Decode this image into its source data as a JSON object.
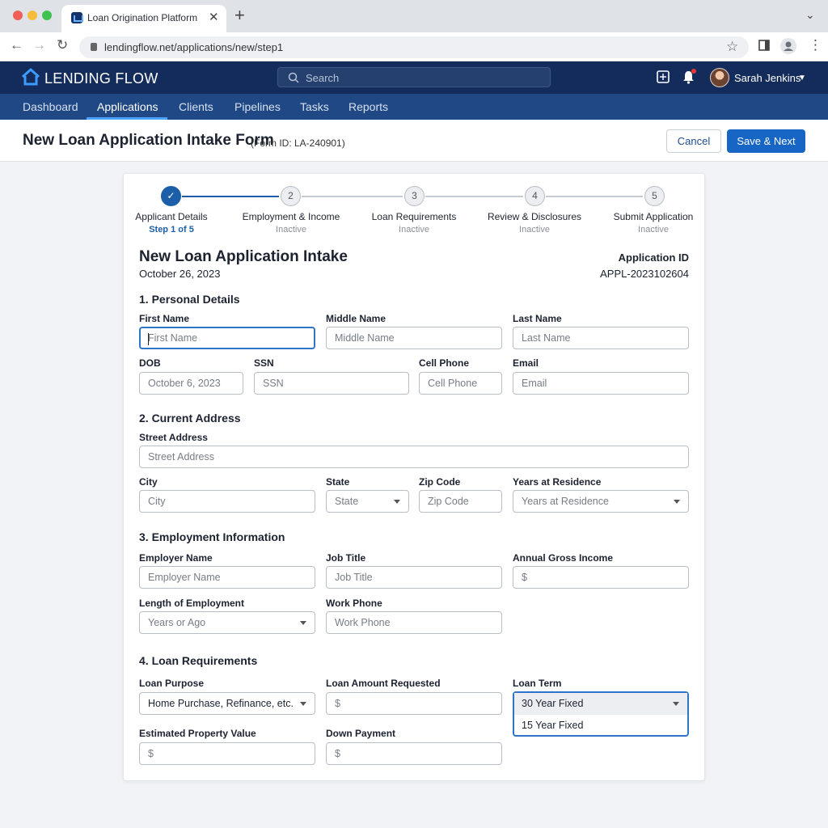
{
  "browser": {
    "tab_title": "Loan Origination Platform",
    "url": "lendingflow.net/applications/new/step1"
  },
  "app": {
    "brand": "LENDING FLOW",
    "search_placeholder": "Search",
    "user_name": "Sarah Jenkins",
    "nav": [
      "Dashboard",
      "Applications",
      "Clients",
      "Pipelines",
      "Tasks",
      "Reports"
    ],
    "active_nav": "Applications"
  },
  "page": {
    "title": "New Loan Application Intake Form",
    "form_id": "(Form ID: LA-240901)",
    "cancel_label": "Cancel",
    "save_label": "Save & Next"
  },
  "stepper": [
    {
      "number": "✓",
      "label": "Applicant Details",
      "status": "Step 1 of 5",
      "state": "done"
    },
    {
      "number": "2",
      "label": "Employment & Income",
      "status": "Inactive",
      "state": "todo"
    },
    {
      "number": "3",
      "label": "Loan Requirements",
      "status": "Inactive",
      "state": "todo"
    },
    {
      "number": "4",
      "label": "Review & Disclosures",
      "status": "Inactive",
      "state": "todo"
    },
    {
      "number": "5",
      "label": "Submit Application",
      "status": "Inactive",
      "state": "todo"
    }
  ],
  "form": {
    "heading": "New Loan Application Intake",
    "date": "October 26, 2023",
    "app_id_label": "Application ID",
    "app_id_value": "APPL-2023102604",
    "sections": {
      "personal": "1. Personal Details",
      "address": "2. Current Address",
      "employment": "3. Employment Information",
      "loan": "4. Loan Requirements"
    },
    "fields": {
      "first_name": {
        "label": "First Name",
        "placeholder": "First Name"
      },
      "middle_name": {
        "label": "Middle Name",
        "placeholder": "Middle Name"
      },
      "last_name": {
        "label": "Last Name",
        "placeholder": "Last Name"
      },
      "dob": {
        "label": "DOB",
        "value": "October 6, 2023"
      },
      "ssn": {
        "label": "SSN",
        "placeholder": "SSN"
      },
      "cell_phone": {
        "label": "Cell Phone",
        "placeholder": "Cell Phone"
      },
      "email": {
        "label": "Email",
        "placeholder": "Email"
      },
      "street": {
        "label": "Street Address",
        "placeholder": "Street Address"
      },
      "city": {
        "label": "City",
        "placeholder": "City"
      },
      "state": {
        "label": "State",
        "placeholder": "State"
      },
      "zip": {
        "label": "Zip Code",
        "placeholder": "Zip Code"
      },
      "years_residence": {
        "label": "Years at Residence",
        "placeholder": "Years at Residence"
      },
      "employer": {
        "label": "Employer Name",
        "placeholder": "Employer Name"
      },
      "job_title": {
        "label": "Job Title",
        "placeholder": "Job Title"
      },
      "annual_income": {
        "label": "Annual Gross Income",
        "placeholder": "$"
      },
      "length_employment": {
        "label": "Length of Employment",
        "placeholder": "Years or Ago"
      },
      "work_phone": {
        "label": "Work Phone",
        "placeholder": "Work Phone"
      },
      "loan_purpose": {
        "label": "Loan Purpose",
        "value": "Home Purchase, Refinance, etc."
      },
      "loan_amount": {
        "label": "Loan Amount Requested",
        "placeholder": "$"
      },
      "loan_term": {
        "label": "Loan Term",
        "value": "30 Year Fixed",
        "options": [
          "30 Year Fixed",
          "15 Year Fixed"
        ]
      },
      "property_value": {
        "label": "Estimated Property Value",
        "placeholder": "$"
      },
      "down_payment": {
        "label": "Down Payment",
        "placeholder": "$"
      }
    }
  },
  "colors": {
    "app_header": "#132c5b",
    "nav_bar": "#1f4884",
    "primary_button": "#1766c5",
    "step_done": "#1c5fa8",
    "focus_border": "#2e74c8"
  }
}
